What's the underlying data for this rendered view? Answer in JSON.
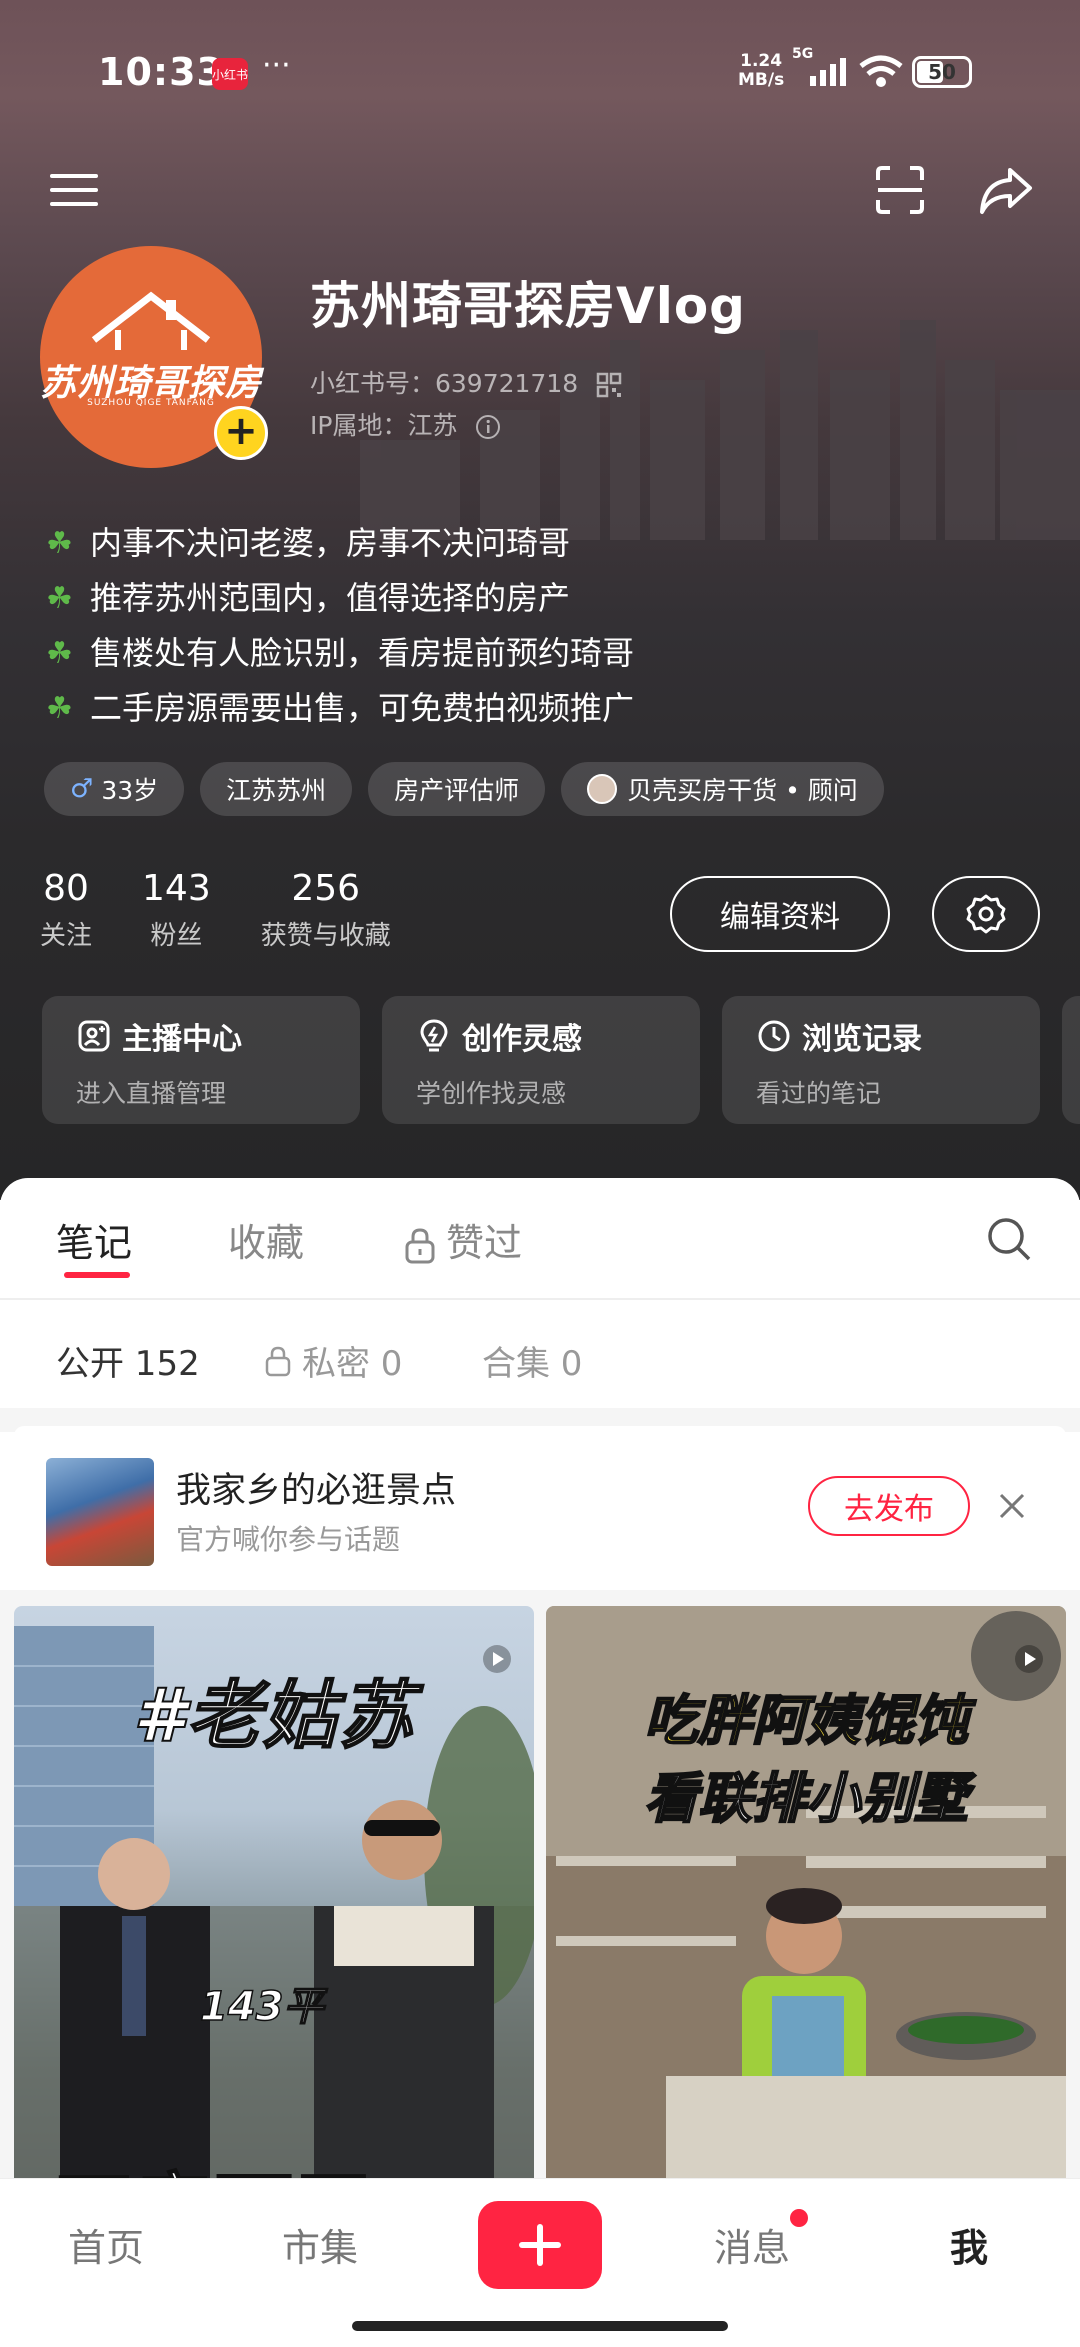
{
  "status_bar": {
    "time": "10:33",
    "app_badge": "小红书",
    "dots": "···",
    "net_speed_value": "1.24",
    "net_speed_unit": "MB/s",
    "network": "5G",
    "battery": "50"
  },
  "profile": {
    "name": "苏州琦哥探房Vlog",
    "id_text": "小红书号：639721718",
    "ip_text": "IP属地：江苏",
    "avatar_logo": "苏州琦哥探房",
    "avatar_sub": "SUZHOU QIGE TANFANG",
    "avatar_plus": "+"
  },
  "bio": [
    "内事不决问老婆，房事不决问琦哥",
    "推荐苏州范围内，值得选择的房产",
    "售楼处有人脸识别，看房提前预约琦哥",
    "二手房源需要出售，可免费拍视频推广"
  ],
  "tags": {
    "age": "33岁",
    "location": "江苏苏州",
    "job": "房产评估师",
    "org": "贝壳买房干货 • 顾问"
  },
  "stats": [
    {
      "num": "80",
      "label": "关注"
    },
    {
      "num": "143",
      "label": "粉丝"
    },
    {
      "num": "256",
      "label": "获赞与收藏"
    }
  ],
  "buttons": {
    "edit_profile": "编辑资料"
  },
  "cards": [
    {
      "title": "主播中心",
      "sub": "进入直播管理"
    },
    {
      "title": "创作灵感",
      "sub": "学创作找灵感"
    },
    {
      "title": "浏览记录",
      "sub": "看过的笔记"
    }
  ],
  "tabs": {
    "notes": "笔记",
    "collections": "收藏",
    "liked": "赞过"
  },
  "subtabs": {
    "public": "公开 152",
    "private": "私密 0",
    "albums": "合集 0"
  },
  "topic": {
    "title": "我家乡的必逛景点",
    "subtitle": "官方喊你参与话题",
    "publish": "去发布"
  },
  "posts": [
    {
      "caption": "#老姑苏",
      "small": "143平",
      "bottom": "四房两卫"
    },
    {
      "caption1": "吃胖阿姨馄饨",
      "caption2": "看联排小别墅"
    }
  ],
  "bottom_nav": {
    "home": "首页",
    "market": "市集",
    "messages": "消息",
    "me": "我"
  },
  "colors": {
    "accent": "#ff2442",
    "avatar_bg": "#e46a39",
    "plus_badge": "#ffd41f"
  }
}
